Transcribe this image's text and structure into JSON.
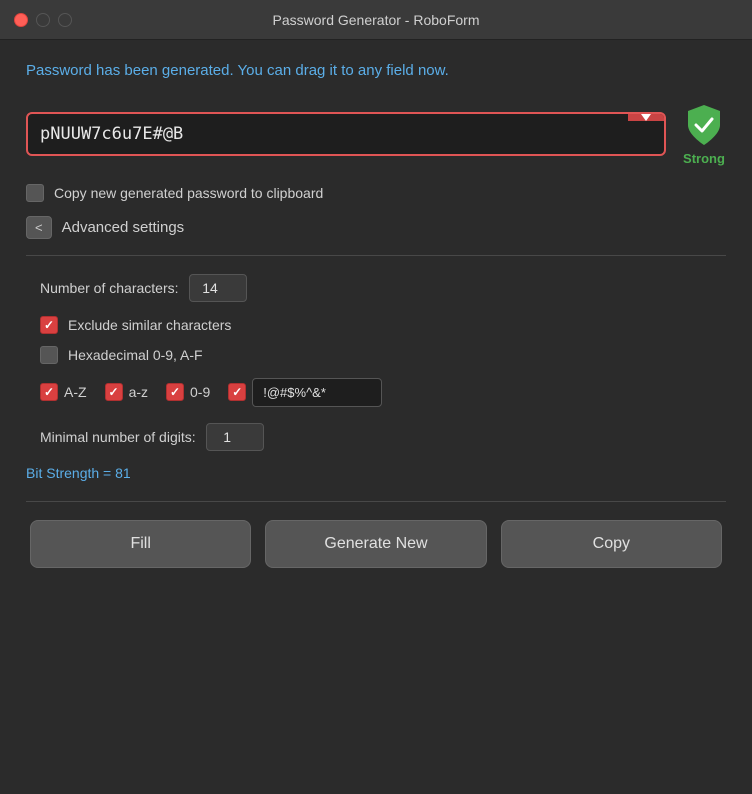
{
  "window": {
    "title": "Password Generator - RoboForm"
  },
  "message": "Password has been generated. You can drag it to any field now.",
  "password": {
    "value": "pNUUW7c6u7E#@B",
    "dropdown_label": "dropdown"
  },
  "strength": {
    "label": "Strong",
    "color": "#4caf50"
  },
  "clipboard_checkbox": {
    "label": "Copy new generated password to clipboard",
    "checked": false
  },
  "advanced": {
    "button_label": "<",
    "label": "Advanced settings"
  },
  "settings": {
    "num_characters_label": "Number of characters:",
    "num_characters_value": "14",
    "exclude_similar_label": "Exclude similar characters",
    "exclude_similar_checked": true,
    "hexadecimal_label": "Hexadecimal 0-9, A-F",
    "hexadecimal_checked": false,
    "az_label": "A-Z",
    "az_checked": true,
    "az_lower_label": "a-z",
    "az_lower_checked": true,
    "digits_label": "0-9",
    "digits_checked": true,
    "special_checked": true,
    "special_value": "!@#$%^&*",
    "min_digits_label": "Minimal number of digits:",
    "min_digits_value": "1"
  },
  "bit_strength": {
    "label": "Bit Strength = 81"
  },
  "buttons": {
    "fill": "Fill",
    "generate": "Generate New",
    "copy": "Copy"
  }
}
